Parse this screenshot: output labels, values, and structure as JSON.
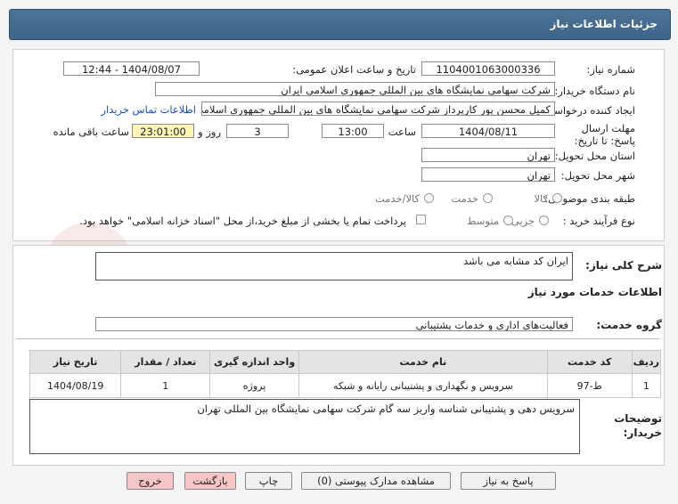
{
  "header": {
    "title": "جزئیات اطلاعات نیاز"
  },
  "watermark": {
    "text": "AriaTender.net"
  },
  "form": {
    "need_number_label": "شماره نیاز:",
    "need_number": "1104001063000336",
    "announce_label": "تاریخ و ساعت اعلان عمومی:",
    "announce_value": "1404/08/07 - 12:44",
    "buyer_org_label": "نام دستگاه خریدار:",
    "buyer_org": "شرکت سهامی نمایشگاه های بین المللی جمهوری اسلامی ایران",
    "requester_label": "ایجاد کننده درخواست:",
    "requester": "کمیل محسن پور کارپرداز شرکت سهامی نمایشگاه های بین المللی جمهوری اسلامی ایران",
    "contact_link": "اطلاعات تماس خریدار",
    "deadline_label": "مهلت ارسال پاسخ: تا تاریخ:",
    "deadline_date": "1404/08/11",
    "time_label": "ساعت",
    "deadline_time": "13:00",
    "days_value": "3",
    "days_label": "روز و",
    "remaining_time": "23:01:00",
    "remaining_label": "ساعت باقی مانده",
    "province_label": "استان محل تحویل:",
    "province": "تهران",
    "city_label": "شهر محل تحویل:",
    "city": "تهران",
    "category_label": "طبقه بندی موضوعی:",
    "category_options": [
      "کالا",
      "خدمت",
      "کالا/خدمت"
    ],
    "purchase_type_label": "نوع فرآیند خرید :",
    "purchase_options": [
      "جزیی",
      "متوسط"
    ],
    "payment_note": "پرداخت تمام یا بخشی از مبلغ خرید،از محل \"اسناد خزانه اسلامی\" خواهد بود."
  },
  "details": {
    "summary_label": "شرح کلی نیاز:",
    "summary": "ایران کد مشابه می باشد",
    "services_heading": "اطلاعات خدمات مورد نیاز",
    "group_label": "گروه خدمت:",
    "group": "فعالیت‌های اداری و خدمات پشتیبانی",
    "table_headers": [
      "ردیف",
      "کد خدمت",
      "نام خدمت",
      "واحد اندازه گیری",
      "تعداد / مقدار",
      "تاریخ نیاز"
    ],
    "table_rows": [
      [
        "1",
        "ط-97",
        "سرویس و نگهداری و پشتیبانی رایانه و شبکه",
        "پروژه",
        "1",
        "1404/08/19"
      ]
    ],
    "buyer_notes_label": "توضیحات خریدار:",
    "buyer_notes": "سرویس دهی و پشتیبانی شناسه واریز سه گام شرکت سهامی نمایشگاه بین المللی تهران"
  },
  "buttons": {
    "reply": "پاسخ به نیاز",
    "attachments": "مشاهده مدارک پیوستی (0)",
    "print": "چاپ",
    "back": "بازگشت",
    "exit": "خروج"
  }
}
